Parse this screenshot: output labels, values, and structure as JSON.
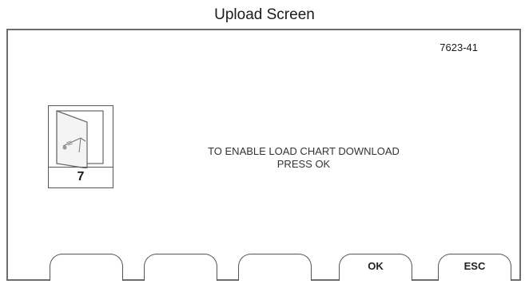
{
  "caption": "Upload Screen",
  "figure_id": "7623-41",
  "icon": {
    "name": "load-chart-door-icon",
    "number": "7"
  },
  "message": {
    "line1": "TO ENABLE LOAD CHART DOWNLOAD",
    "line2": "PRESS OK"
  },
  "softkeys": [
    {
      "label": ""
    },
    {
      "label": ""
    },
    {
      "label": ""
    },
    {
      "label": "OK"
    },
    {
      "label": "ESC"
    }
  ]
}
